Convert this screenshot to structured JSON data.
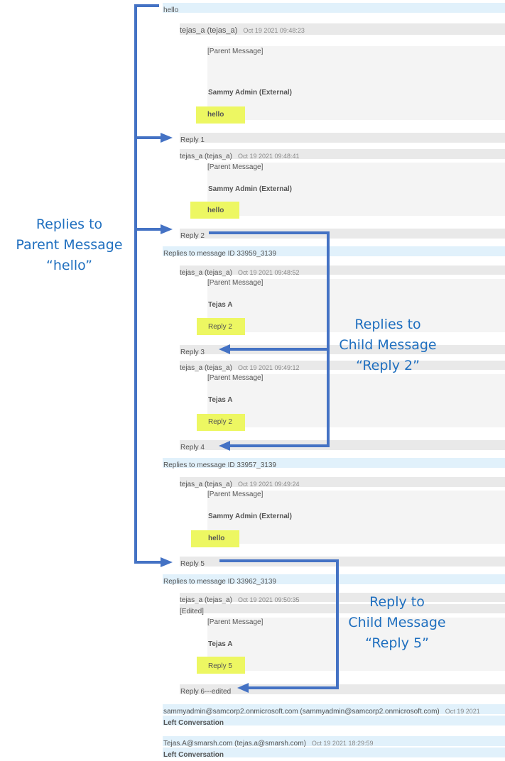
{
  "thread": {
    "root_message": "hello",
    "messages": [
      {
        "sender": "tejas_a (tejas_a)",
        "timestamp": "Oct 19 2021 09:48:23",
        "parent_label": "[Parent Message]",
        "parent_author": "Sammy Admin (External)",
        "parent_text": "hello",
        "body": "Reply 1"
      },
      {
        "sender": "tejas_a (tejas_a)",
        "timestamp": "Oct 19 2021 09:48:41",
        "parent_label": "[Parent Message]",
        "parent_author": "Sammy Admin (External)",
        "parent_text": "hello",
        "body": "Reply 2"
      },
      {
        "group_header": "Replies to message ID 33959_3139"
      },
      {
        "sender": "tejas_a (tejas_a)",
        "timestamp": "Oct 19 2021 09:48:52",
        "parent_label": "[Parent Message]",
        "parent_author": "Tejas A",
        "parent_text": "Reply 2",
        "body": "Reply 3"
      },
      {
        "sender": "tejas_a (tejas_a)",
        "timestamp": "Oct 19 2021 09:49:12",
        "parent_label": "[Parent Message]",
        "parent_author": "Tejas A",
        "parent_text": "Reply 2",
        "body": "Reply 4"
      },
      {
        "group_header": "Replies to message ID 33957_3139"
      },
      {
        "sender": "tejas_a (tejas_a)",
        "timestamp": "Oct 19 2021 09:49:24",
        "parent_label": "[Parent Message]",
        "parent_author": "Sammy Admin (External)",
        "parent_text": "hello",
        "body": "Reply 5"
      },
      {
        "group_header": "Replies to message ID 33962_3139"
      },
      {
        "sender": "tejas_a (tejas_a)",
        "timestamp": "Oct 19 2021 09:50:35",
        "edited_label": "[Edited]",
        "parent_label": "[Parent Message]",
        "parent_author": "Tejas A",
        "parent_text": "Reply 5",
        "body": "Reply 6---edited"
      }
    ],
    "events": [
      {
        "sender": "sammyadmin@samcorp2.onmicrosoft.com (sammyadmin@samcorp2.onmicrosoft.com)",
        "timestamp": "Oct 19 2021",
        "text": "Left Conversation"
      },
      {
        "sender": "Tejas.A@smarsh.com (tejas.a@smarsh.com)",
        "timestamp": "Oct 19 2021 18:29:59",
        "text": "Left Conversation"
      }
    ]
  },
  "annotations": {
    "parent_replies": [
      "Replies to",
      "Parent Message",
      "“hello”"
    ],
    "child_reply2": [
      "Replies to",
      "Child Message",
      "“Reply 2”"
    ],
    "child_reply5": [
      "Reply to",
      "Child Message",
      "“Reply 5”"
    ]
  },
  "colors": {
    "annotation_blue": "#4472c4",
    "annotation_text": "#1f6fbf",
    "highlight": "#ecf75a",
    "header_bar": "#e1f1fb",
    "meta_bar": "#e9e9e9",
    "quote_box": "#f4f4f4"
  }
}
